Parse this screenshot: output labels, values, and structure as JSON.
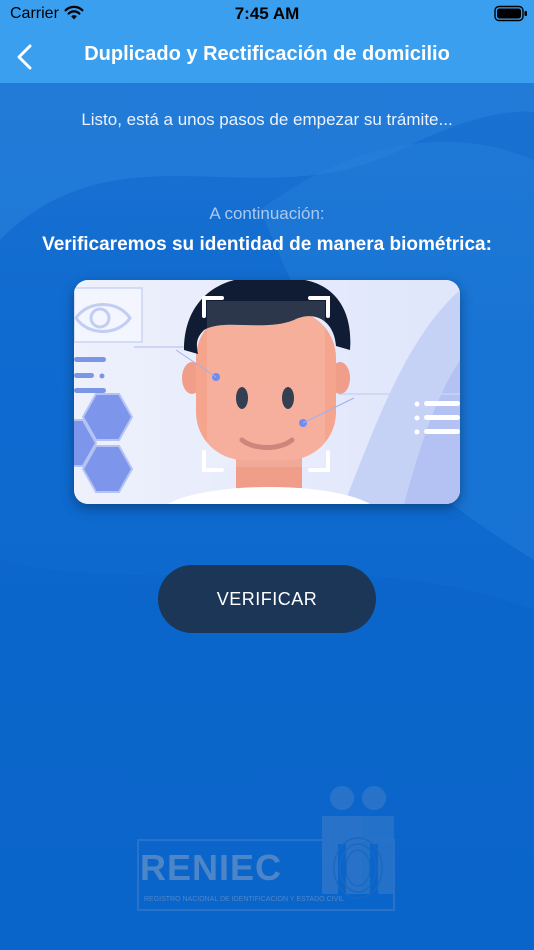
{
  "status_bar": {
    "carrier": "Carrier",
    "time": "7:45 AM",
    "wifi_icon": "wifi-icon",
    "battery_icon": "battery-icon"
  },
  "nav": {
    "title": "Duplicado y Rectificación de domicilio",
    "back_icon": "chevron-left-icon"
  },
  "content": {
    "intro": "Listo, está a unos pasos de empezar su trámite...",
    "continuation_label": "A continuación:",
    "heading": "Verificaremos su identidad de manera biométrica:",
    "illustration": "face-scan-illustration",
    "button_label": "VERIFICAR"
  },
  "footer": {
    "logo_text": "RENIEC",
    "logo_subtitle": "REGISTRO NACIONAL DE IDENTIFICACIÓN Y ESTADO CIVIL"
  },
  "colors": {
    "header": "#3b9ff0",
    "background": "#0f6bd0",
    "button": "#1c3658"
  }
}
